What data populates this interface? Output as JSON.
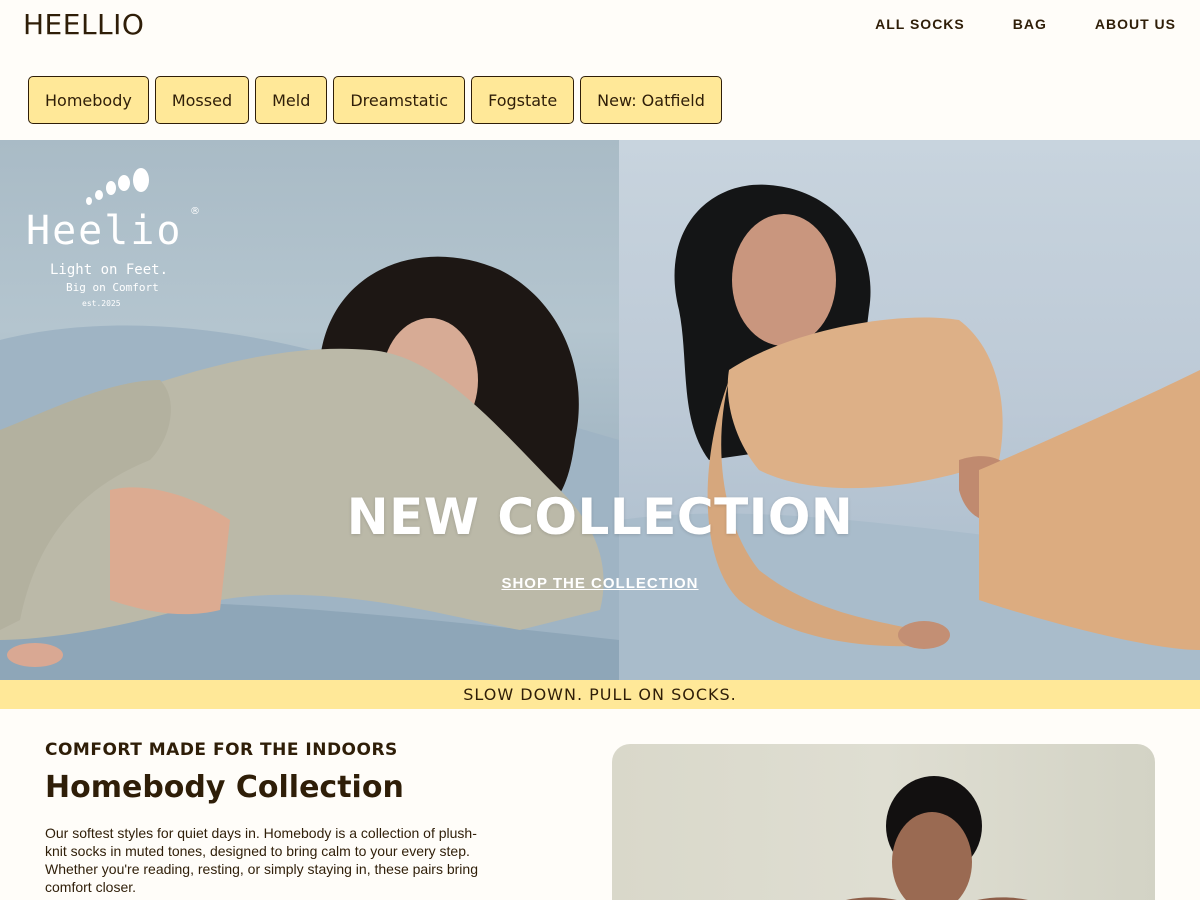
{
  "header": {
    "brand": "HEELLIO",
    "nav": [
      "ALL SOCKS",
      "BAG",
      "ABOUT US"
    ]
  },
  "collections": [
    "Homebody",
    "Mossed",
    "Meld",
    "Dreamstatic",
    "Fogstate",
    "New: Oatfield"
  ],
  "hero": {
    "logo": {
      "name": "Heelio",
      "registered": "®",
      "tagline_1": "Light on Feet.",
      "tagline_2": "Big  on Comfort",
      "est": "est.2025"
    },
    "title": "NEW COLLECTION",
    "cta": "SHOP THE COLLECTION"
  },
  "banner": "SLOW DOWN. PULL ON SOCKS.",
  "feature": {
    "kicker": "COMFORT MADE FOR THE INDOORS",
    "title": "Homebody Collection",
    "body": "Our softest styles for quiet days in. Homebody is a collection of plush-knit socks in muted tones, designed to bring calm to your every step. Whether you're reading, resting, or simply staying in, these pairs bring comfort closer."
  },
  "colors": {
    "text": "#2f1e08",
    "accent_yellow": "#ffe898",
    "background": "#fffdf9"
  }
}
